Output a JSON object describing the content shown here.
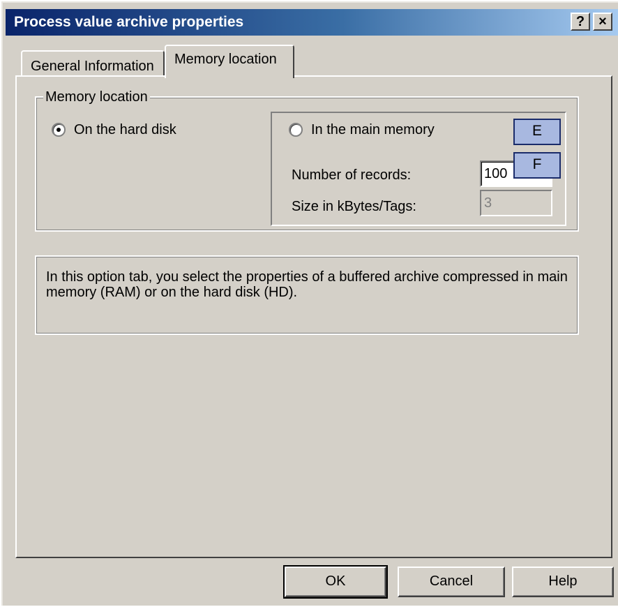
{
  "window": {
    "title": "Process value archive properties",
    "help_button": "?",
    "close_button": "×"
  },
  "tabs": [
    {
      "label": "General Information",
      "active": false
    },
    {
      "label": "Memory location",
      "active": true
    }
  ],
  "memory_group": {
    "legend": "Memory location",
    "option_hard_disk": {
      "label": "On the hard disk",
      "selected": true
    },
    "option_main_memory": {
      "label": "In the main memory",
      "selected": false
    },
    "records_label": "Number of records:",
    "records_value": "100",
    "size_label": "Size in kBytes/Tags:",
    "size_value": "3"
  },
  "callouts": {
    "e": "E",
    "f": "F"
  },
  "info_text": "In this option tab, you select the properties of a buffered archive compressed in main memory (RAM) or on the hard disk (HD).",
  "buttons": {
    "ok": "OK",
    "cancel": "Cancel",
    "help": "Help"
  },
  "colors": {
    "titlebar_start": "#0a246a",
    "titlebar_end": "#a6caf0",
    "face": "#d4d0c8",
    "callout": "#a8b8e0"
  }
}
